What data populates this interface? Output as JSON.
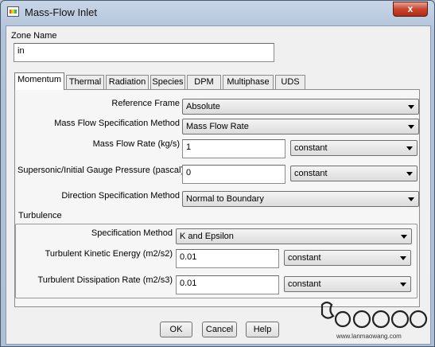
{
  "window": {
    "title": "Mass-Flow Inlet",
    "close_glyph": "x"
  },
  "zone": {
    "label": "Zone Name",
    "value": "in"
  },
  "tabs": [
    "Momentum",
    "Thermal",
    "Radiation",
    "Species",
    "DPM",
    "Multiphase",
    "UDS"
  ],
  "momentum": {
    "reference_frame": {
      "label": "Reference Frame",
      "value": "Absolute"
    },
    "mass_flow_spec": {
      "label": "Mass Flow Specification Method",
      "value": "Mass Flow Rate"
    },
    "mass_flow_rate": {
      "label": "Mass Flow Rate (kg/s)",
      "value": "1",
      "profile": "constant"
    },
    "gauge_pressure": {
      "label": "Supersonic/Initial Gauge Pressure (pascal)",
      "value": "0",
      "profile": "constant"
    },
    "direction_spec": {
      "label": "Direction Specification Method",
      "value": "Normal to Boundary"
    }
  },
  "turbulence": {
    "title": "Turbulence",
    "spec_method": {
      "label": "Specification Method",
      "value": "K and Epsilon"
    },
    "kinetic_energy": {
      "label": "Turbulent Kinetic Energy (m2/s2)",
      "value": "0.01",
      "profile": "constant"
    },
    "dissipation_rate": {
      "label": "Turbulent Dissipation Rate (m2/s3)",
      "value": "0.01",
      "profile": "constant"
    }
  },
  "buttons": {
    "ok": "OK",
    "cancel": "Cancel",
    "help": "Help"
  },
  "watermark": {
    "url": "www.lanmaowang.com"
  },
  "colors": {
    "close_button": "#c7452f",
    "window_frame": "#b2c3d9",
    "dialog_background": "#f0f0f0"
  }
}
